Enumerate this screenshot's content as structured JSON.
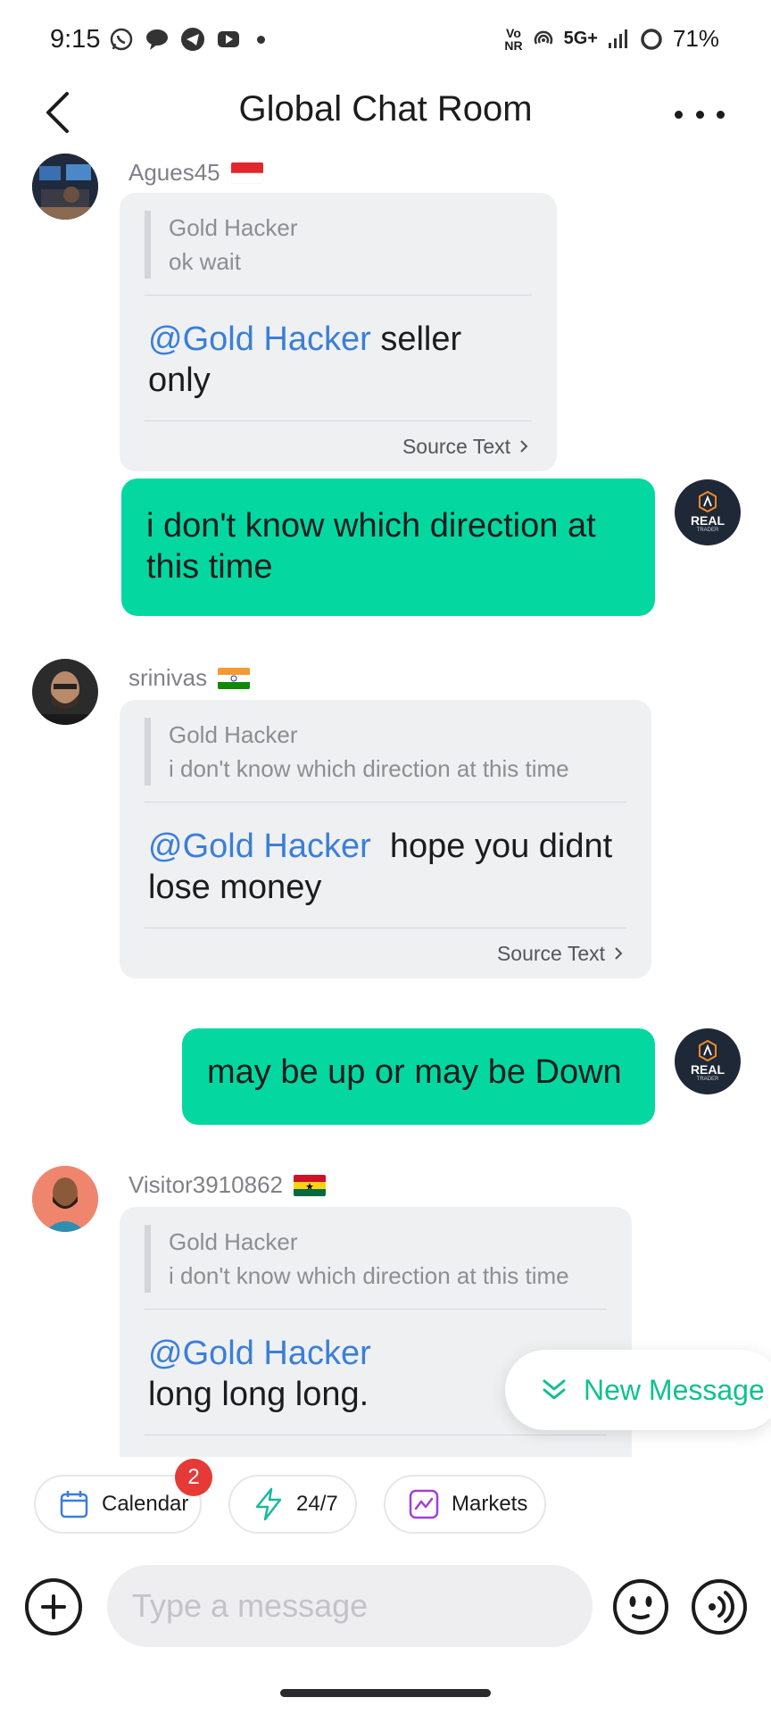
{
  "status_bar": {
    "time": "9:15",
    "network_small": "Vo\nNR",
    "network": "5G+",
    "battery": "71%"
  },
  "header": {
    "title": "Global Chat Room"
  },
  "messages": [
    {
      "type": "incoming",
      "user": "Agues45",
      "flag": "indonesia-flag",
      "quote_name": "Gold Hacker",
      "quote_text": "ok wait",
      "mention": "@Gold Hacker",
      "text": " seller only",
      "source_label": "Source Text"
    },
    {
      "type": "outgoing",
      "text": "i don't know which direction at this time",
      "badge": "REAL",
      "badge_sub": "TRADER"
    },
    {
      "type": "incoming",
      "user": "srinivas",
      "flag": "india-flag",
      "quote_name": "Gold Hacker",
      "quote_text": "i don't know which direction at this time",
      "mention": "@Gold Hacker",
      "text": "  hope you didnt lose money",
      "source_label": "Source Text"
    },
    {
      "type": "outgoing",
      "text": "may be up or may be Down",
      "badge": "REAL",
      "badge_sub": "TRADER"
    },
    {
      "type": "incoming",
      "user": "Visitor3910862",
      "flag": "ghana-flag",
      "quote_name": "Gold Hacker",
      "quote_text": "i don't know which direction at this time",
      "mention": "@Gold Hacker",
      "text": "long long long."
    }
  ],
  "new_message": {
    "label": "New Message"
  },
  "chips": [
    {
      "label": "Calendar",
      "badge": "2",
      "icon": "calendar-icon"
    },
    {
      "label": "24/7",
      "icon": "lightning-icon"
    },
    {
      "label": "Markets",
      "icon": "chart-icon"
    }
  ],
  "input": {
    "placeholder": "Type a message"
  },
  "colors": {
    "accent_green": "#05d7a0",
    "mention_blue": "#3a7fd8",
    "bubble_gray": "#eff0f2",
    "badge_red": "#e53a36"
  }
}
